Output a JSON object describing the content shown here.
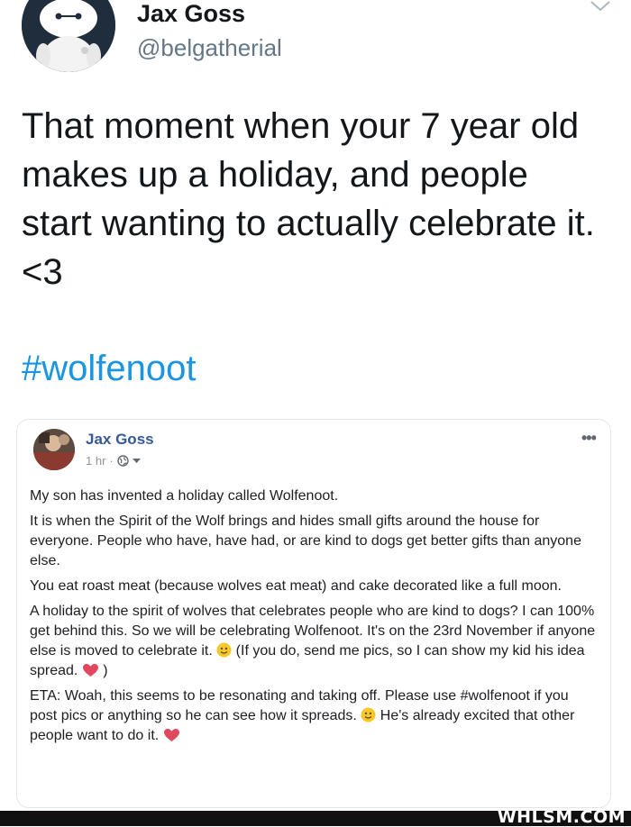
{
  "tweet": {
    "author_name": "Jax Goss",
    "author_handle": "@belgatherial",
    "avatar_icon": "robot-mascot-avatar",
    "menu_icon": "chevron-down-icon",
    "text": "That moment when your 7 year old makes up a holiday, and people start wanting to actually celebrate it. <3",
    "hashtag": "#wolfenoot",
    "link_color": "#1b95e0"
  },
  "fb_post": {
    "author_name": "Jax Goss",
    "time": "1 hr",
    "separator": "·",
    "privacy_icon": "globe-icon",
    "more_icon": "ellipsis-icon",
    "more_label": "•••",
    "paragraphs": {
      "p1": "My son has invented a holiday called Wolfenoot.",
      "p2": "It is when the Spirit of the Wolf brings and hides small gifts around the house for everyone. People who have, have had, or are kind to dogs get better gifts than anyone else.",
      "p3": "You eat roast meat (because wolves eat meat) and cake decorated like a full moon.",
      "p4a": "A holiday to the spirit of wolves that celebrates people who are kind to dogs? I can 100% get behind this. So we will be celebrating Wolfenoot. It's on the 23rd November if anyone else is moved to celebrate it. ",
      "p4b": " (If you do, send me pics, so I can show my kid his idea spread. ",
      "p4c": " )",
      "p5a": "ETA: Woah, this seems to be resonating and taking off. Please use #wolfenoot if you post pics or anything so he can see how it spreads. ",
      "p5b": " He's already excited that other people want to do it. "
    },
    "name_color": "#365899"
  },
  "watermark": "WHLSM.COM"
}
